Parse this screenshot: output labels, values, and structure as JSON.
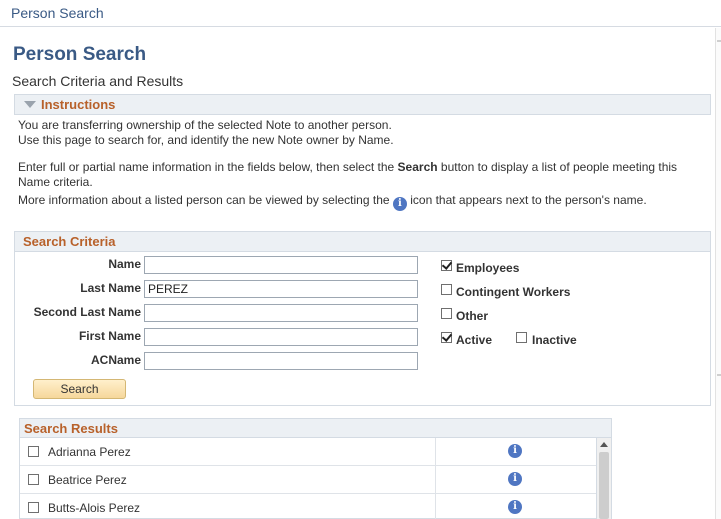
{
  "window": {
    "title": "Person Search"
  },
  "page": {
    "title": "Person Search",
    "subtitle": "Search Criteria and Results"
  },
  "instructions": {
    "header": "Instructions",
    "line1": "You are transferring ownership of the selected Note to another person.",
    "line2": "Use this page to search for, and identify the new Note owner by Name.",
    "line3_pre": "Enter full or partial name information in the fields below, then select the ",
    "line3_bold": "Search",
    "line3_post": " button to display a list of people meeting this",
    "line4": "Name criteria.",
    "line5_pre": "More information about a listed person can be viewed by selecting the ",
    "line5_post": " icon that appears next to the person's name.",
    "icon": "info-icon"
  },
  "criteria": {
    "header": "Search Criteria",
    "fields": {
      "name": {
        "label": "Name",
        "value": ""
      },
      "last_name": {
        "label": "Last Name",
        "value": "PEREZ"
      },
      "second_last_name": {
        "label": "Second Last Name",
        "value": ""
      },
      "first_name": {
        "label": "First Name",
        "value": ""
      },
      "acname": {
        "label": "ACName",
        "value": ""
      }
    },
    "options": {
      "employees": {
        "label": "Employees",
        "checked": true
      },
      "contingent": {
        "label": "Contingent Workers",
        "checked": false
      },
      "other": {
        "label": "Other",
        "checked": false
      },
      "active": {
        "label": "Active",
        "checked": true
      },
      "inactive": {
        "label": "Inactive",
        "checked": false
      }
    },
    "search_button": "Search"
  },
  "results": {
    "header": "Search Results",
    "rows": [
      {
        "name": "Adrianna Perez",
        "checked": false
      },
      {
        "name": "Beatrice Perez",
        "checked": false
      },
      {
        "name": "Butts-Alois Perez",
        "checked": false
      }
    ]
  },
  "colors": {
    "title": "#3a5a85",
    "section_label": "#b8612a",
    "info_icon": "#4f76c2",
    "button": "#f6d79b"
  }
}
